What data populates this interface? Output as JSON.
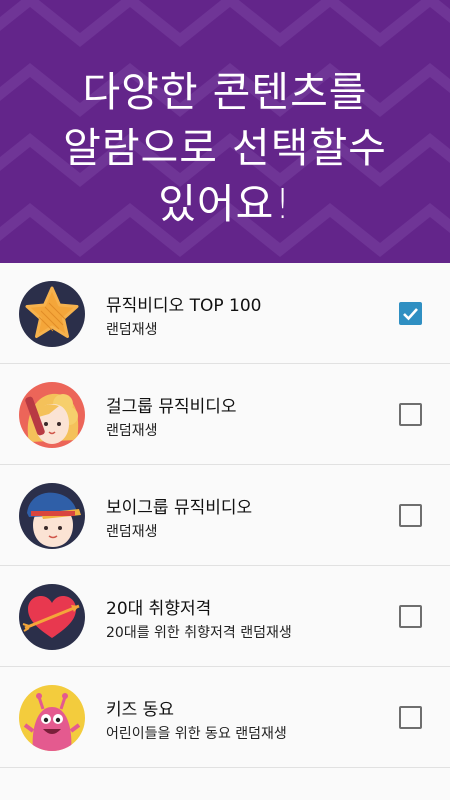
{
  "header": {
    "headline_lines": [
      "다양한 콘텐츠를",
      "알람으로 선택할수",
      "있어요!"
    ],
    "background_color": "#63258a"
  },
  "items": [
    {
      "title": "뮤직비디오 TOP 100",
      "subtitle": "랜덤재생",
      "checked": true,
      "icon": "star-icon"
    },
    {
      "title": "걸그룹 뮤직비디오",
      "subtitle": "랜덤재생",
      "checked": false,
      "icon": "girl-face-icon"
    },
    {
      "title": "보이그룹 뮤직비디오",
      "subtitle": "랜덤재생",
      "checked": false,
      "icon": "boy-face-icon"
    },
    {
      "title": "20대 취향저격",
      "subtitle": "20대를 위한 취향저격 랜덤재생",
      "checked": false,
      "icon": "heart-arrow-icon"
    },
    {
      "title": "키즈 동요",
      "subtitle": "어린이들을 위한 동요 랜덤재생",
      "checked": false,
      "icon": "monster-icon"
    }
  ],
  "colors": {
    "accent": "#2f8fc2",
    "checkbox_border": "#6e6e6e"
  }
}
